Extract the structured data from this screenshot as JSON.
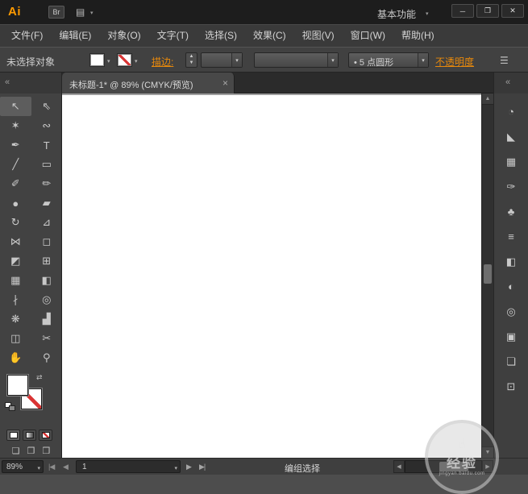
{
  "colors": {
    "accent": "#e8890c",
    "logo": "#ff9a00",
    "red": "#d93434"
  },
  "glyphs": {
    "caret": "▾",
    "stepper_up": "▲",
    "stepper_down": "▼"
  },
  "titlebar": {
    "app_logo": "Ai",
    "bridge_label": "Br",
    "layout_icon": "▤",
    "workspace": "基本功能",
    "minimize": "─",
    "restore": "❐",
    "close": "✕"
  },
  "menubar": {
    "items": [
      {
        "label": "文件(F)"
      },
      {
        "label": "编辑(E)"
      },
      {
        "label": "对象(O)"
      },
      {
        "label": "文字(T)"
      },
      {
        "label": "选择(S)"
      },
      {
        "label": "效果(C)"
      },
      {
        "label": "视图(V)"
      },
      {
        "label": "窗口(W)"
      },
      {
        "label": "帮助(H)"
      }
    ]
  },
  "controlbar": {
    "selection_status": "未选择对象",
    "stroke_label": "描边:",
    "brush_bullet": "•",
    "brush_name": "5 点圆形",
    "opacity_label": "不透明度",
    "panel_menu_icon": "☰"
  },
  "tabrow": {
    "collapse_left": "«",
    "tab_title": "未标题-1* @ 89% (CMYK/预览)",
    "tab_close": "×",
    "collapse_right": "«"
  },
  "tools": [
    {
      "id": "selection",
      "glyph": "↖"
    },
    {
      "id": "direct-selection",
      "glyph": "⇖"
    },
    {
      "id": "magic-wand",
      "glyph": "✶"
    },
    {
      "id": "lasso",
      "glyph": "∾"
    },
    {
      "id": "pen",
      "glyph": "✒"
    },
    {
      "id": "type",
      "glyph": "T"
    },
    {
      "id": "line-segment",
      "glyph": "╱"
    },
    {
      "id": "rectangle",
      "glyph": "▭"
    },
    {
      "id": "paintbrush",
      "glyph": "✐"
    },
    {
      "id": "pencil",
      "glyph": "✏"
    },
    {
      "id": "blob-brush",
      "glyph": "●"
    },
    {
      "id": "eraser",
      "glyph": "▰"
    },
    {
      "id": "rotate",
      "glyph": "↻"
    },
    {
      "id": "scale",
      "glyph": "⊿"
    },
    {
      "id": "width",
      "glyph": "⋈"
    },
    {
      "id": "free-transform",
      "glyph": "◻"
    },
    {
      "id": "shape-builder",
      "glyph": "◩"
    },
    {
      "id": "perspective-grid",
      "glyph": "⊞"
    },
    {
      "id": "mesh",
      "glyph": "▦"
    },
    {
      "id": "gradient",
      "glyph": "◧"
    },
    {
      "id": "eyedropper",
      "glyph": "∤"
    },
    {
      "id": "blend",
      "glyph": "◎"
    },
    {
      "id": "symbol-sprayer",
      "glyph": "❋"
    },
    {
      "id": "column-graph",
      "glyph": "▟"
    },
    {
      "id": "artboard",
      "glyph": "◫"
    },
    {
      "id": "slice",
      "glyph": "✂"
    },
    {
      "id": "hand",
      "glyph": "✋"
    },
    {
      "id": "zoom",
      "glyph": "⚲"
    }
  ],
  "tool_bottom": {
    "swap_icon": "⇄",
    "modes": [
      "❏",
      "❐",
      "❒"
    ]
  },
  "right_dock": {
    "panels": [
      {
        "id": "color",
        "glyph": "◔"
      },
      {
        "id": "color-guide",
        "glyph": "◣"
      },
      {
        "id": "swatches",
        "glyph": "▦"
      },
      {
        "id": "brushes",
        "glyph": "✑"
      },
      {
        "id": "symbols",
        "glyph": "♣"
      },
      {
        "id": "stroke",
        "glyph": "≡"
      },
      {
        "id": "gradient",
        "glyph": "◧"
      },
      {
        "id": "transparency",
        "glyph": "◐"
      },
      {
        "id": "appearance",
        "glyph": "◎"
      },
      {
        "id": "graphic-styles",
        "glyph": "▣"
      },
      {
        "id": "layers",
        "glyph": "❏"
      },
      {
        "id": "artboards",
        "glyph": "⊡"
      }
    ]
  },
  "canvas": {
    "scroll_up": "▲",
    "scroll_down": "▼"
  },
  "statusbar": {
    "zoom": "89%",
    "first": "|◀",
    "prev": "◀",
    "artboard_number": "1",
    "next": "▶",
    "last": "▶|",
    "status_text": "编组选择",
    "scroll_left": "◀",
    "scroll_right": "▶"
  },
  "watermark": {
    "icon": "☝",
    "text": "经验",
    "domain": "jingyan.baidu.com"
  }
}
